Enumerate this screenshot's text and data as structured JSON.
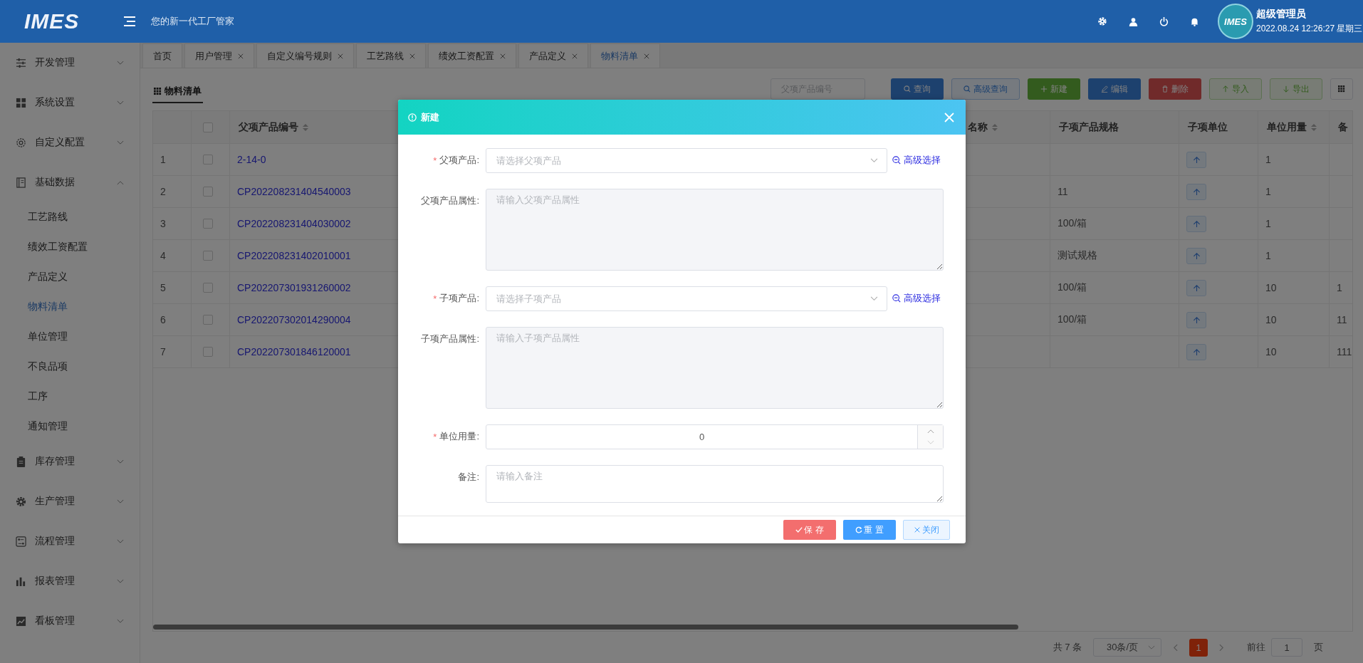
{
  "header": {
    "logo": "IMES",
    "tagline": "您的新一代工厂管家",
    "avatar_logo": "IMES",
    "user_name": "超级管理员",
    "datetime": "2022.08.24 12:26:27 星期三"
  },
  "sidebar": {
    "items": [
      {
        "label": "开发管理",
        "expanded": false
      },
      {
        "label": "系统设置",
        "expanded": false
      },
      {
        "label": "自定义配置",
        "expanded": false
      },
      {
        "label": "基础数据",
        "expanded": true,
        "children": [
          {
            "label": "工艺路线",
            "selected": false
          },
          {
            "label": "绩效工资配置",
            "selected": false
          },
          {
            "label": "产品定义",
            "selected": false
          },
          {
            "label": "物料清单",
            "selected": true
          },
          {
            "label": "单位管理",
            "selected": false
          },
          {
            "label": "不良品项",
            "selected": false
          },
          {
            "label": "工序",
            "selected": false
          },
          {
            "label": "通知管理",
            "selected": false
          }
        ]
      },
      {
        "label": "库存管理",
        "expanded": false
      },
      {
        "label": "生产管理",
        "expanded": false
      },
      {
        "label": "流程管理",
        "expanded": false
      },
      {
        "label": "报表管理",
        "expanded": false
      },
      {
        "label": "看板管理",
        "expanded": false
      }
    ]
  },
  "tabs": [
    {
      "label": "首页",
      "closable": false,
      "selected": false
    },
    {
      "label": "用户管理",
      "closable": true,
      "selected": false
    },
    {
      "label": "自定义编号规则",
      "closable": true,
      "selected": false
    },
    {
      "label": "工艺路线",
      "closable": true,
      "selected": false
    },
    {
      "label": "绩效工资配置",
      "closable": true,
      "selected": false
    },
    {
      "label": "产品定义",
      "closable": true,
      "selected": false
    },
    {
      "label": "物料清单",
      "closable": true,
      "selected": true
    }
  ],
  "page": {
    "title": "物料清单",
    "search": {
      "placeholder": "父项产品编号"
    },
    "buttons": [
      {
        "label": "查询",
        "kind": "primary"
      },
      {
        "label": "高级查询",
        "kind": "outline"
      },
      {
        "label": "新建",
        "kind": "success"
      },
      {
        "label": "编辑",
        "kind": "primary"
      },
      {
        "label": "删除",
        "kind": "danger"
      },
      {
        "label": "导入",
        "kind": "plain-success"
      },
      {
        "label": "导出",
        "kind": "plain-success"
      }
    ]
  },
  "table": {
    "select_all_checked": false,
    "columns": [
      {
        "label": "父项产品编号",
        "sortable": true
      },
      {
        "label": "名称",
        "sortable": true
      },
      {
        "label": "子项产品规格",
        "sortable": false
      },
      {
        "label": "子项单位",
        "sortable": false
      },
      {
        "label": "单位用量",
        "sortable": true
      },
      {
        "label": "备"
      }
    ],
    "rows": [
      {
        "index": "1",
        "checked": false,
        "parent_code": "2-14-0",
        "unit_qty": "1"
      },
      {
        "index": "2",
        "checked": false,
        "parent_code": "CP202208231404540003",
        "child_spec": "11",
        "unit_qty": "1"
      },
      {
        "index": "3",
        "checked": false,
        "parent_code": "CP202208231404030002",
        "child_spec": "100/箱",
        "unit_qty": "1"
      },
      {
        "index": "4",
        "checked": false,
        "parent_code": "CP202208231402010001",
        "child_spec": "测试规格",
        "unit_qty": "1"
      },
      {
        "index": "5",
        "checked": false,
        "parent_code": "CP202207301931260002",
        "child_spec": "100/箱",
        "unit_qty": "10",
        "note": "1"
      },
      {
        "index": "6",
        "checked": false,
        "parent_code": "CP202207302014290004",
        "child_spec": "100/箱",
        "unit_qty": "10",
        "note": "11"
      },
      {
        "index": "7",
        "checked": false,
        "parent_code": "CP202207301846120001",
        "unit_qty": "10",
        "note": "111"
      }
    ]
  },
  "pagination": {
    "total": "共 7 条",
    "page_size": "30条/页",
    "pages": [
      {
        "label": "1",
        "selected": true
      }
    ],
    "goto_label": "前往",
    "goto_value": "1",
    "page_suffix": "页"
  },
  "dialog": {
    "title": "新建",
    "fields": [
      {
        "kind": "select",
        "label": "父项产品:",
        "required_mark": "*",
        "placeholder": "请选择父项产品",
        "link": "高级选择"
      },
      {
        "kind": "textarea",
        "label": "父项产品属性:",
        "placeholder": "请输入父项产品属性"
      },
      {
        "kind": "select",
        "label": "子项产品:",
        "required_mark": "*",
        "placeholder": "请选择子项产品",
        "link": "高级选择"
      },
      {
        "kind": "textarea",
        "label": "子项产品属性:",
        "placeholder": "请输入子项产品属性"
      },
      {
        "kind": "number",
        "label": "单位用量:",
        "required_mark": "*",
        "value": "0"
      },
      {
        "kind": "memo",
        "label": "备注:",
        "placeholder": "请输入备注"
      }
    ],
    "buttons": [
      {
        "label": "保 存",
        "kind": "danger"
      },
      {
        "label": "重 置",
        "kind": "primary"
      },
      {
        "label": "关闭",
        "kind": "plain"
      }
    ]
  }
}
